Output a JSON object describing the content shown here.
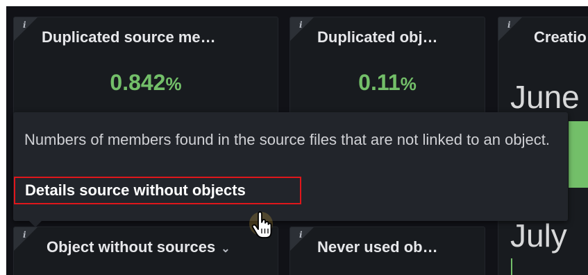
{
  "panels": [
    {
      "info": "i",
      "title": "Duplicated source me…",
      "value": "0.842",
      "unit": "%"
    },
    {
      "info": "i",
      "title": "Duplicated obj…",
      "value": "0.11",
      "unit": "%"
    },
    {
      "info": "i",
      "title": "Creatio",
      "big_1": "June",
      "big_2": "July"
    },
    {
      "info": "i",
      "title": "Object without sources",
      "menu_icon": "chevron-down-icon"
    },
    {
      "info": "i",
      "title": "Never used ob…"
    }
  ],
  "tooltip": {
    "description": "Numbers of members found in the source files that are not linked to an object.",
    "link_label": "Details source without objects"
  },
  "colors": {
    "background": "#111217",
    "panel": "#181b1f",
    "value_green": "#73bf69",
    "highlight_border": "#e0161b"
  },
  "icons": [
    "info-icon",
    "chevron-down-icon",
    "hand-pointer-cursor"
  ]
}
